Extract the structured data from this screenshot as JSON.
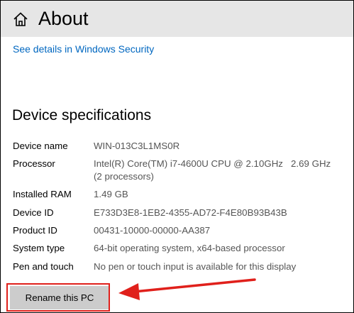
{
  "header": {
    "title": "About",
    "home_icon": "home-icon"
  },
  "security": {
    "link_text": "See details in Windows Security"
  },
  "device_specs": {
    "heading": "Device specifications",
    "rows": [
      {
        "label": "Device name",
        "value": "WIN-013C3L1MS0R"
      },
      {
        "label": "Processor",
        "value": "Intel(R) Core(TM) i7-4600U CPU @ 2.10GHz   2.69 GHz",
        "value_line2": "(2 processors)"
      },
      {
        "label": "Installed RAM",
        "value": "1.49 GB"
      },
      {
        "label": "Device ID",
        "value": "E733D3E8-1EB2-4355-AD72-F4E80B93B43B"
      },
      {
        "label": "Product ID",
        "value": "00431-10000-00000-AA387"
      },
      {
        "label": "System type",
        "value": "64-bit operating system, x64-based processor"
      },
      {
        "label": "Pen and touch",
        "value": "No pen or touch input is available for this display"
      }
    ]
  },
  "actions": {
    "rename_label": "Rename this PC"
  },
  "annotation": {
    "color": "#e0201b",
    "arrow_icon": "arrow-left-icon"
  }
}
